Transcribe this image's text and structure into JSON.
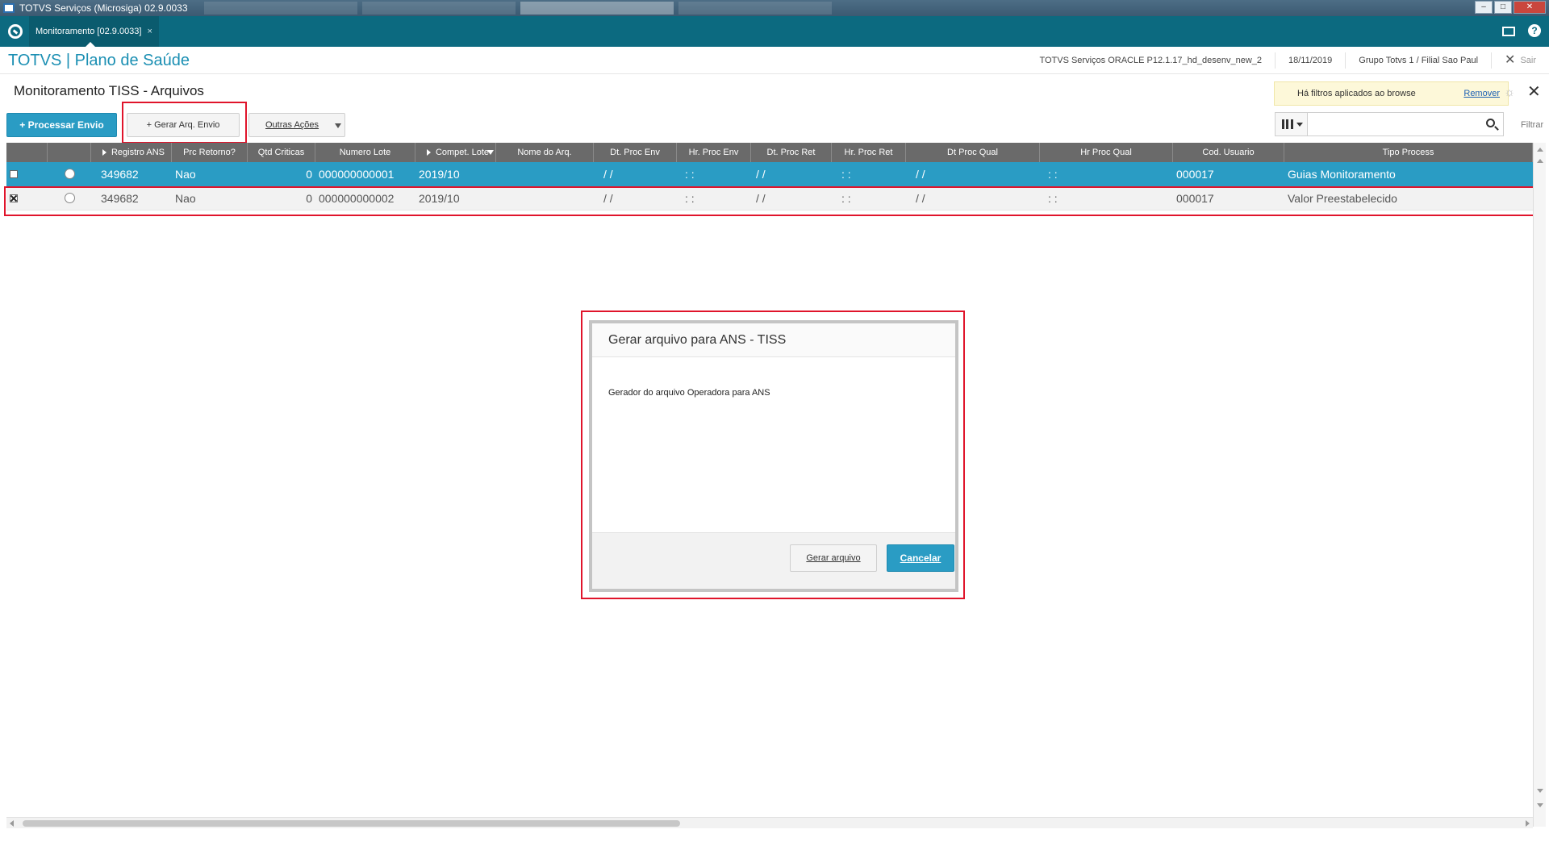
{
  "window": {
    "title": "TOTVS Serviços (Microsiga) 02.9.0033",
    "controls": [
      "–",
      "□",
      "✕"
    ]
  },
  "app_bar": {
    "tab_label": "Monitoramento [02.9.0033]",
    "tab_close": "×",
    "help_label": "?"
  },
  "header": {
    "brand": "TOTVS | Plano de Saúde",
    "environment": "TOTVS Serviços ORACLE P12.1.17_hd_desenv_new_2",
    "date": "18/11/2019",
    "branch": "Grupo Totvs 1 / Filial Sao Paul",
    "exit_label": "Sair"
  },
  "page": {
    "title": "Monitoramento TISS - Arquivos",
    "filter_notice": "Há filtros aplicados ao browse",
    "filter_remove": "Remover",
    "close": "✕"
  },
  "toolbar": {
    "processar_label": "+ Processar Envio",
    "gerar_label": "+ Gerar Arq. Envio",
    "outras_label": "Outras Ações",
    "search_placeholder": "",
    "filter_label": "Filtrar"
  },
  "grid": {
    "columns": [
      "",
      "",
      "Registro ANS",
      "Prc Retorno?",
      "Qtd Criticas",
      "Numero Lote",
      "Compet. Lote",
      "Nome do Arq.",
      "Dt. Proc Env",
      "Hr. Proc Env",
      "Dt. Proc Ret",
      "Hr. Proc Ret",
      "Dt Proc Qual",
      "Hr Proc Qual",
      "Cod. Usuario",
      "Tipo Process"
    ],
    "rows": [
      {
        "checked": false,
        "selected": true,
        "registro_ans": "349682",
        "prc_retorno": "Nao",
        "qtd_criticas": "0",
        "numero_lote": "000000000001",
        "compet_lote": "2019/10",
        "nome_arq": "",
        "dt_proc_env": "/ /",
        "hr_proc_env": ": :",
        "dt_proc_ret": "/ /",
        "hr_proc_ret": ": :",
        "dt_proc_qual": "/ /",
        "hr_proc_qual": ": :",
        "cod_usuario": "000017",
        "tipo_process": "Guias Monitoramento"
      },
      {
        "checked": true,
        "selected": false,
        "registro_ans": "349682",
        "prc_retorno": "Nao",
        "qtd_criticas": "0",
        "numero_lote": "000000000002",
        "compet_lote": "2019/10",
        "nome_arq": "",
        "dt_proc_env": "/ /",
        "hr_proc_env": ": :",
        "dt_proc_ret": "/ /",
        "hr_proc_ret": ": :",
        "dt_proc_qual": "/ /",
        "hr_proc_qual": ": :",
        "cod_usuario": "000017",
        "tipo_process": "Valor Preestabelecido"
      }
    ]
  },
  "dialog": {
    "title": "Gerar arquivo para ANS - TISS",
    "message": "Gerador do arquivo Operadora para ANS",
    "gerar_label": "Gerar arquivo",
    "cancelar_label": "Cancelar"
  },
  "colors": {
    "app_bar": "#0c6a80",
    "brand": "#1b8fb3",
    "primary": "#2a9cc4",
    "highlight": "#e0142b",
    "grid_header": "#6a6a6a"
  }
}
